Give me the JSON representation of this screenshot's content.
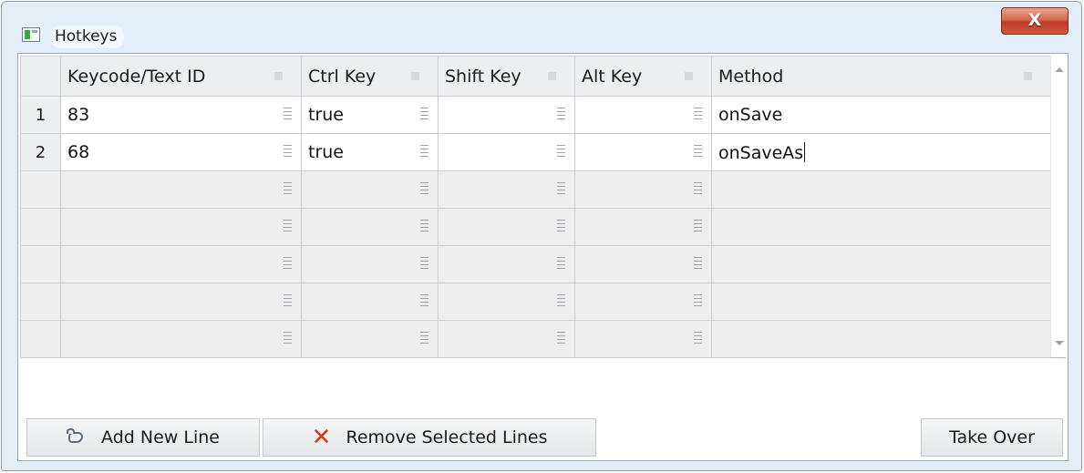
{
  "window": {
    "title": "Hotkeys",
    "close_glyph": "X",
    "icon": "window-app-icon"
  },
  "grid": {
    "columns": [
      {
        "label": "Keycode/Text ID"
      },
      {
        "label": "Ctrl Key"
      },
      {
        "label": "Shift Key"
      },
      {
        "label": "Alt Key"
      },
      {
        "label": "Method"
      }
    ],
    "rows": [
      {
        "num": "1",
        "keycode": "83",
        "ctrl": "true",
        "shift": "",
        "alt": "",
        "method": "onSave"
      },
      {
        "num": "2",
        "keycode": "68",
        "ctrl": "true",
        "shift": "",
        "alt": "",
        "method": "onSaveAs"
      },
      {
        "num": "",
        "keycode": "",
        "ctrl": "",
        "shift": "",
        "alt": "",
        "method": ""
      },
      {
        "num": "",
        "keycode": "",
        "ctrl": "",
        "shift": "",
        "alt": "",
        "method": ""
      },
      {
        "num": "",
        "keycode": "",
        "ctrl": "",
        "shift": "",
        "alt": "",
        "method": ""
      },
      {
        "num": "",
        "keycode": "",
        "ctrl": "",
        "shift": "",
        "alt": "",
        "method": ""
      },
      {
        "num": "",
        "keycode": "",
        "ctrl": "",
        "shift": "",
        "alt": "",
        "method": ""
      }
    ]
  },
  "buttons": {
    "add_line": "Add New Line",
    "remove_lines": "Remove Selected Lines",
    "take_over": "Take Over"
  },
  "colors": {
    "frame": "#e4eef9",
    "close_button": "#c0392b",
    "remove_icon": "#d23a1f"
  }
}
